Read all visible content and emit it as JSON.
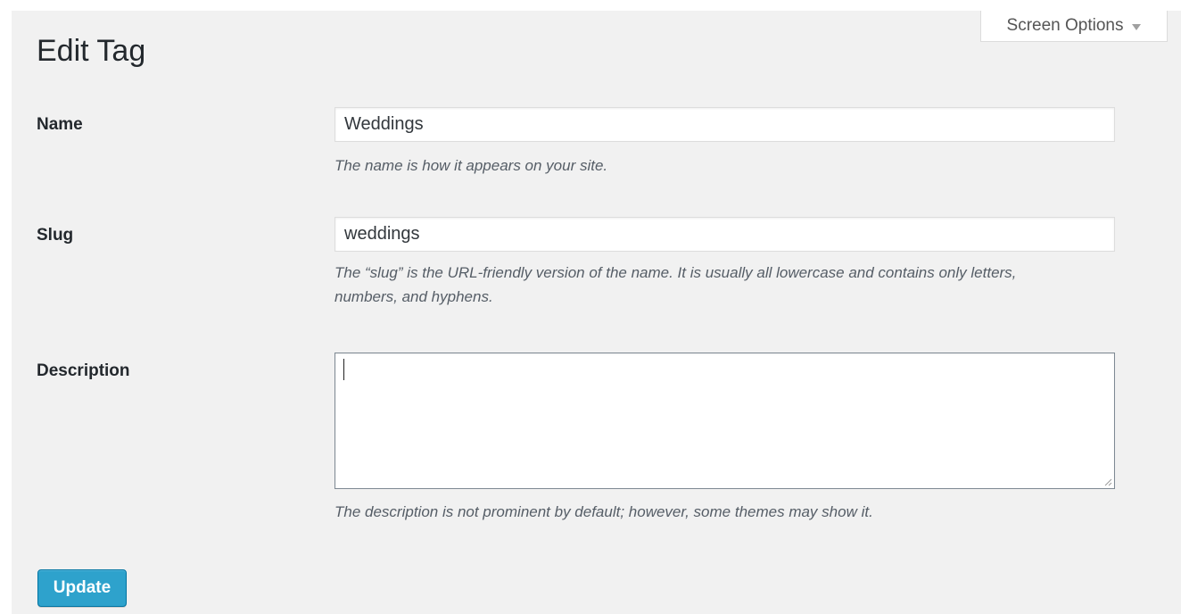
{
  "page": {
    "title": "Edit Tag"
  },
  "screen_options": {
    "label": "Screen Options",
    "icon": "chevron-down-icon"
  },
  "form": {
    "name": {
      "label": "Name",
      "value": "Weddings",
      "help": "The name is how it appears on your site."
    },
    "slug": {
      "label": "Slug",
      "value": "weddings",
      "help_line1": "The “slug” is the URL-friendly version of the name. It is usually all lowercase and contains only letters,",
      "help_line2": "numbers, and hyphens."
    },
    "description": {
      "label": "Description",
      "value": "",
      "help": "The description is not prominent by default; however, some themes may show it."
    },
    "submit": {
      "label": "Update"
    }
  },
  "colors": {
    "background": "#f1f1f1",
    "primary_button": "#2ea2cc",
    "primary_button_border": "#0074a2",
    "help_text": "#555d66"
  }
}
